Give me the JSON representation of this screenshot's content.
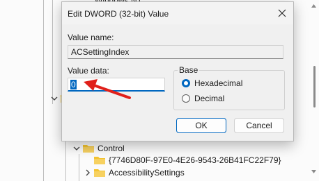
{
  "dialog": {
    "title": "Edit DWORD (32-bit) Value",
    "value_name_label": "Value name:",
    "value_name": "ACSettingIndex",
    "value_data_label": "Value data:",
    "value_data": "0",
    "base_label": "Base",
    "radio_hex_label": "Hexadecimal",
    "radio_dec_label": "Decimal",
    "base_selected": "Hexadecimal",
    "ok_label": "OK",
    "cancel_label": "Cancel"
  },
  "tree": {
    "partial_top_label": "Windows NT",
    "control_label": "Control",
    "guid_label": "{7746D80F-97E0-4E26-9543-26B41FC22F79}",
    "accessibility_label": "AccessibilitySettings"
  },
  "colors": {
    "accent": "#0067c0",
    "callout_arrow": "#e0201a",
    "folder": "#f4c430"
  },
  "icons": [
    "close-icon",
    "chevron-down-icon",
    "chevron-right-icon",
    "folder-icon",
    "red-arrow-annotation"
  ]
}
